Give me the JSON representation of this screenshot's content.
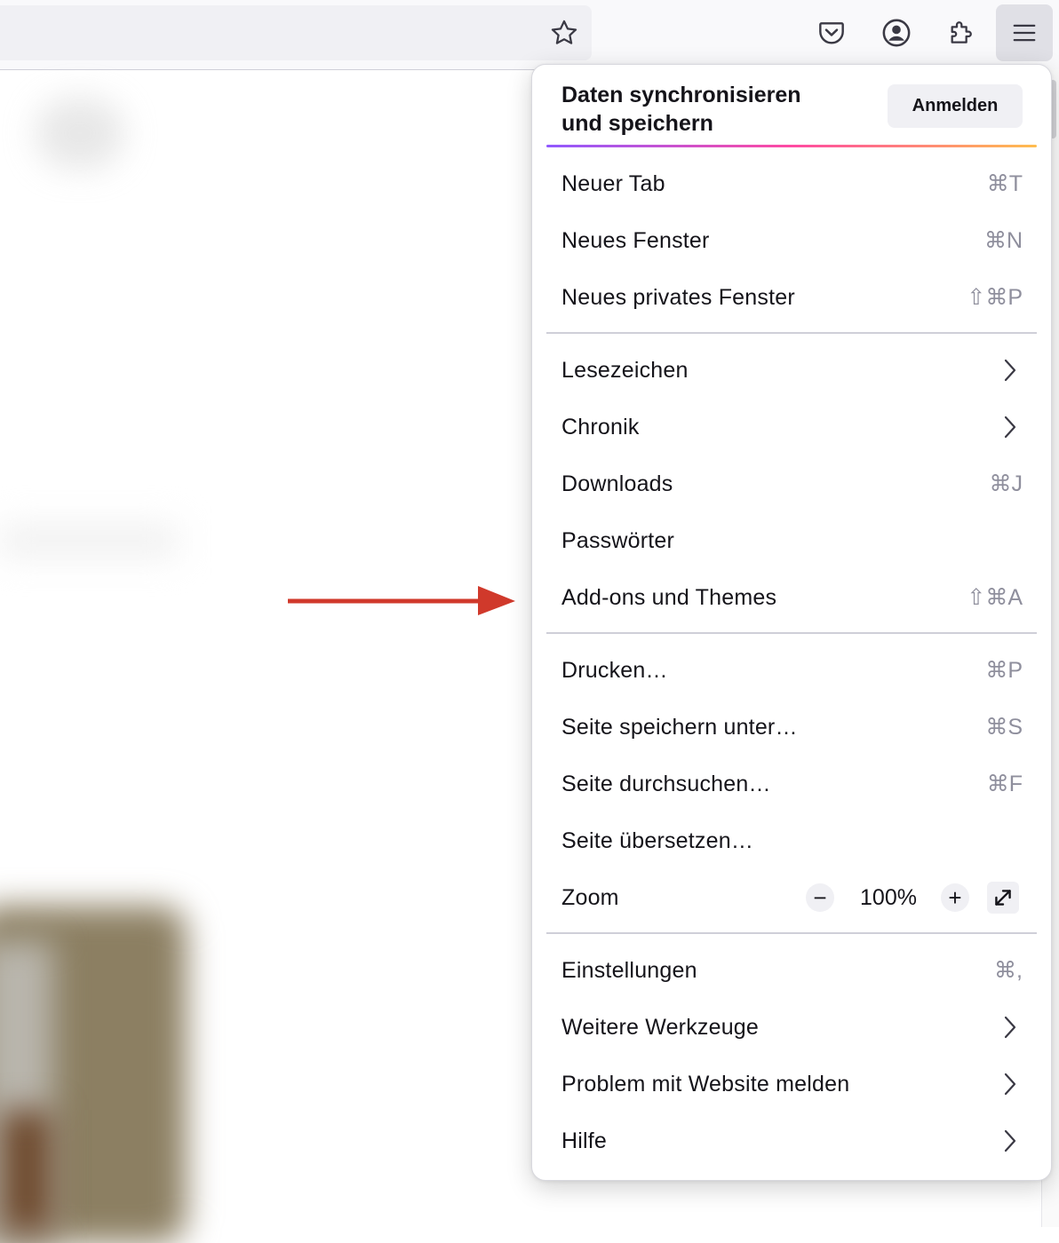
{
  "toolbar": {
    "icons": [
      "star-icon",
      "pocket-icon",
      "account-icon",
      "extensions-icon",
      "hamburger-menu-icon"
    ]
  },
  "menu": {
    "sync": {
      "title": "Daten synchronisieren\nund speichern",
      "signin_label": "Anmelden"
    },
    "items": [
      {
        "label": "Neuer Tab",
        "shortcut": "⌘T"
      },
      {
        "label": "Neues Fenster",
        "shortcut": "⌘N"
      },
      {
        "label": "Neues privates Fenster",
        "shortcut": "⇧⌘P"
      },
      {
        "label": "Lesezeichen",
        "submenu": true
      },
      {
        "label": "Chronik",
        "submenu": true
      },
      {
        "label": "Downloads",
        "shortcut": "⌘J"
      },
      {
        "label": "Passwörter",
        "shortcut": ""
      },
      {
        "label": "Add-ons und Themes",
        "shortcut": "⇧⌘A"
      },
      {
        "label": "Drucken…",
        "shortcut": "⌘P"
      },
      {
        "label": "Seite speichern unter…",
        "shortcut": "⌘S"
      },
      {
        "label": "Seite durchsuchen…",
        "shortcut": "⌘F"
      },
      {
        "label": "Seite übersetzen…",
        "shortcut": ""
      },
      {
        "label": "Einstellungen",
        "shortcut": "⌘,"
      },
      {
        "label": "Weitere Werkzeuge",
        "submenu": true
      },
      {
        "label": "Problem mit Website melden",
        "submenu": true
      },
      {
        "label": "Hilfe",
        "submenu": true
      }
    ],
    "zoom": {
      "label": "Zoom",
      "minus": "−",
      "value": "100%",
      "plus": "+"
    }
  },
  "colors": {
    "accent_arrow": "#d0392b",
    "panel_bg": "#ffffff",
    "shortcut_text": "#8f8f9d"
  }
}
